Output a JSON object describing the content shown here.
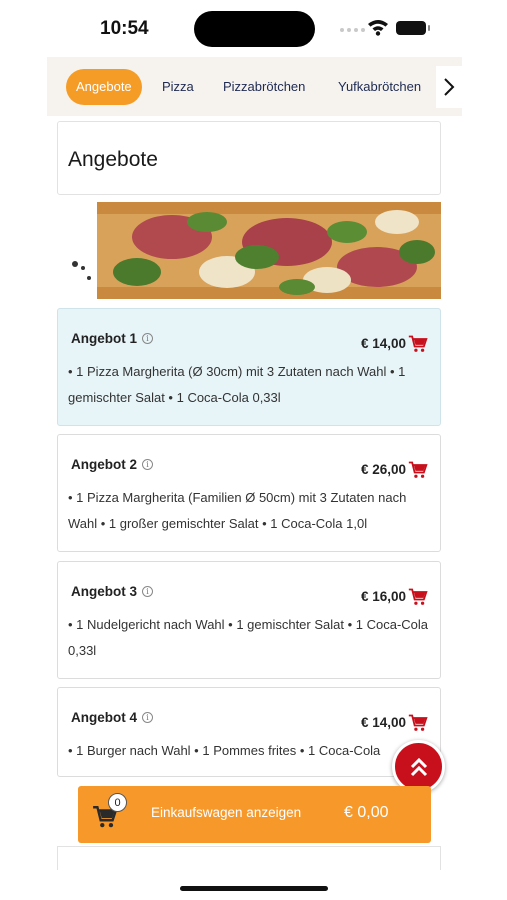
{
  "status_bar": {
    "time": "10:54"
  },
  "tabs": [
    {
      "label": "Angebote",
      "active": true
    },
    {
      "label": "Pizza",
      "active": false
    },
    {
      "label": "Pizzabrötchen",
      "active": false
    },
    {
      "label": "Yufkabrötchen",
      "active": false
    }
  ],
  "section": {
    "title": "Angebote"
  },
  "offers": [
    {
      "name": "Angebot 1",
      "price": "€ 14,00",
      "description": "• 1 Pizza Margherita (Ø 30cm) mit 3 Zutaten nach Wahl • 1 gemischter Salat • 1 Coca-Cola 0,33l"
    },
    {
      "name": "Angebot 2",
      "price": "€ 26,00",
      "description": "• 1 Pizza Margherita (Familien Ø 50cm) mit 3 Zutaten nach Wahl • 1 großer gemischter Salat • 1 Coca-Cola 1,0l"
    },
    {
      "name": "Angebot 3",
      "price": "€ 16,00",
      "description": "• 1 Nudelgericht nach Wahl • 1 gemischter Salat • 1 Coca-Cola 0,33l"
    },
    {
      "name": "Angebot 4",
      "price": "€ 14,00",
      "description": "• 1 Burger nach Wahl • 1 Pommes frites • 1 Coca-Cola"
    }
  ],
  "cart": {
    "count": "0",
    "label": "Einkaufswagen anzeigen",
    "total": "€ 0,00"
  },
  "colors": {
    "accent": "#f59c27",
    "cart_icon": "#c8101d",
    "highlight": "#e7f4f8",
    "nav_text": "#1e2a52"
  },
  "icons": [
    "info-icon",
    "cart-icon",
    "chevron-right-icon",
    "double-chevron-up-icon",
    "wifi-icon",
    "battery-icon"
  ]
}
